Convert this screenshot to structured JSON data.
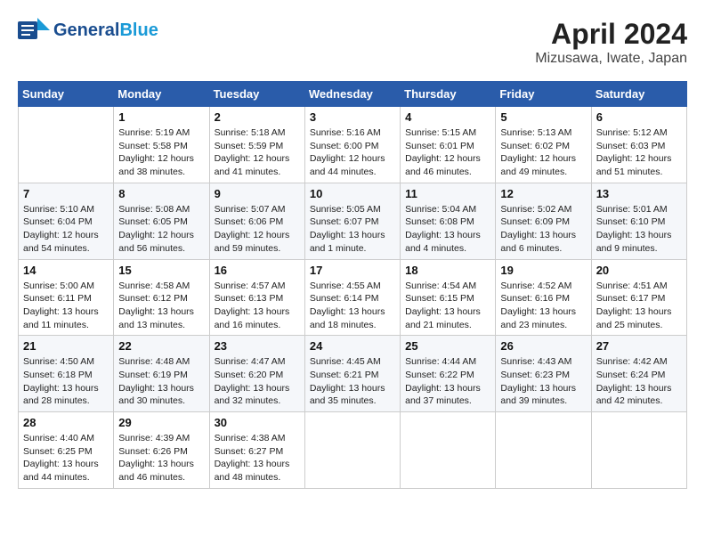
{
  "header": {
    "logo_line1": "General",
    "logo_line2": "Blue",
    "title": "April 2024",
    "subtitle": "Mizusawa, Iwate, Japan"
  },
  "weekdays": [
    "Sunday",
    "Monday",
    "Tuesday",
    "Wednesday",
    "Thursday",
    "Friday",
    "Saturday"
  ],
  "weeks": [
    [
      {
        "day": "",
        "info": ""
      },
      {
        "day": "1",
        "info": "Sunrise: 5:19 AM\nSunset: 5:58 PM\nDaylight: 12 hours\nand 38 minutes."
      },
      {
        "day": "2",
        "info": "Sunrise: 5:18 AM\nSunset: 5:59 PM\nDaylight: 12 hours\nand 41 minutes."
      },
      {
        "day": "3",
        "info": "Sunrise: 5:16 AM\nSunset: 6:00 PM\nDaylight: 12 hours\nand 44 minutes."
      },
      {
        "day": "4",
        "info": "Sunrise: 5:15 AM\nSunset: 6:01 PM\nDaylight: 12 hours\nand 46 minutes."
      },
      {
        "day": "5",
        "info": "Sunrise: 5:13 AM\nSunset: 6:02 PM\nDaylight: 12 hours\nand 49 minutes."
      },
      {
        "day": "6",
        "info": "Sunrise: 5:12 AM\nSunset: 6:03 PM\nDaylight: 12 hours\nand 51 minutes."
      }
    ],
    [
      {
        "day": "7",
        "info": "Sunrise: 5:10 AM\nSunset: 6:04 PM\nDaylight: 12 hours\nand 54 minutes."
      },
      {
        "day": "8",
        "info": "Sunrise: 5:08 AM\nSunset: 6:05 PM\nDaylight: 12 hours\nand 56 minutes."
      },
      {
        "day": "9",
        "info": "Sunrise: 5:07 AM\nSunset: 6:06 PM\nDaylight: 12 hours\nand 59 minutes."
      },
      {
        "day": "10",
        "info": "Sunrise: 5:05 AM\nSunset: 6:07 PM\nDaylight: 13 hours\nand 1 minute."
      },
      {
        "day": "11",
        "info": "Sunrise: 5:04 AM\nSunset: 6:08 PM\nDaylight: 13 hours\nand 4 minutes."
      },
      {
        "day": "12",
        "info": "Sunrise: 5:02 AM\nSunset: 6:09 PM\nDaylight: 13 hours\nand 6 minutes."
      },
      {
        "day": "13",
        "info": "Sunrise: 5:01 AM\nSunset: 6:10 PM\nDaylight: 13 hours\nand 9 minutes."
      }
    ],
    [
      {
        "day": "14",
        "info": "Sunrise: 5:00 AM\nSunset: 6:11 PM\nDaylight: 13 hours\nand 11 minutes."
      },
      {
        "day": "15",
        "info": "Sunrise: 4:58 AM\nSunset: 6:12 PM\nDaylight: 13 hours\nand 13 minutes."
      },
      {
        "day": "16",
        "info": "Sunrise: 4:57 AM\nSunset: 6:13 PM\nDaylight: 13 hours\nand 16 minutes."
      },
      {
        "day": "17",
        "info": "Sunrise: 4:55 AM\nSunset: 6:14 PM\nDaylight: 13 hours\nand 18 minutes."
      },
      {
        "day": "18",
        "info": "Sunrise: 4:54 AM\nSunset: 6:15 PM\nDaylight: 13 hours\nand 21 minutes."
      },
      {
        "day": "19",
        "info": "Sunrise: 4:52 AM\nSunset: 6:16 PM\nDaylight: 13 hours\nand 23 minutes."
      },
      {
        "day": "20",
        "info": "Sunrise: 4:51 AM\nSunset: 6:17 PM\nDaylight: 13 hours\nand 25 minutes."
      }
    ],
    [
      {
        "day": "21",
        "info": "Sunrise: 4:50 AM\nSunset: 6:18 PM\nDaylight: 13 hours\nand 28 minutes."
      },
      {
        "day": "22",
        "info": "Sunrise: 4:48 AM\nSunset: 6:19 PM\nDaylight: 13 hours\nand 30 minutes."
      },
      {
        "day": "23",
        "info": "Sunrise: 4:47 AM\nSunset: 6:20 PM\nDaylight: 13 hours\nand 32 minutes."
      },
      {
        "day": "24",
        "info": "Sunrise: 4:45 AM\nSunset: 6:21 PM\nDaylight: 13 hours\nand 35 minutes."
      },
      {
        "day": "25",
        "info": "Sunrise: 4:44 AM\nSunset: 6:22 PM\nDaylight: 13 hours\nand 37 minutes."
      },
      {
        "day": "26",
        "info": "Sunrise: 4:43 AM\nSunset: 6:23 PM\nDaylight: 13 hours\nand 39 minutes."
      },
      {
        "day": "27",
        "info": "Sunrise: 4:42 AM\nSunset: 6:24 PM\nDaylight: 13 hours\nand 42 minutes."
      }
    ],
    [
      {
        "day": "28",
        "info": "Sunrise: 4:40 AM\nSunset: 6:25 PM\nDaylight: 13 hours\nand 44 minutes."
      },
      {
        "day": "29",
        "info": "Sunrise: 4:39 AM\nSunset: 6:26 PM\nDaylight: 13 hours\nand 46 minutes."
      },
      {
        "day": "30",
        "info": "Sunrise: 4:38 AM\nSunset: 6:27 PM\nDaylight: 13 hours\nand 48 minutes."
      },
      {
        "day": "",
        "info": ""
      },
      {
        "day": "",
        "info": ""
      },
      {
        "day": "",
        "info": ""
      },
      {
        "day": "",
        "info": ""
      }
    ]
  ]
}
